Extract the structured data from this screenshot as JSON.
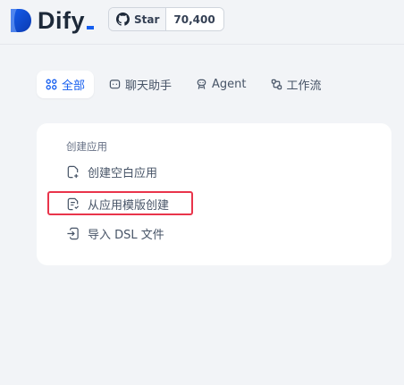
{
  "header": {
    "logo_text": "Dify",
    "github": {
      "star_label": "Star",
      "star_count": "70,400"
    }
  },
  "tabs": [
    {
      "label": "全部",
      "icon": "grid-icon",
      "active": true
    },
    {
      "label": "聊天助手",
      "icon": "chat-bubble-icon",
      "active": false
    },
    {
      "label": "Agent",
      "icon": "robot-icon",
      "active": false
    },
    {
      "label": "工作流",
      "icon": "workflow-icon",
      "active": false
    }
  ],
  "create_card": {
    "title": "创建应用",
    "items": [
      {
        "label": "创建空白应用",
        "icon": "file-plus-icon"
      },
      {
        "label": "从应用模版创建",
        "icon": "file-template-icon",
        "highlighted": true
      },
      {
        "label": "导入 DSL 文件",
        "icon": "file-import-icon"
      }
    ]
  },
  "colors": {
    "accent": "#155eef",
    "background": "#f2f4f7",
    "highlight_border": "#e9344b"
  }
}
